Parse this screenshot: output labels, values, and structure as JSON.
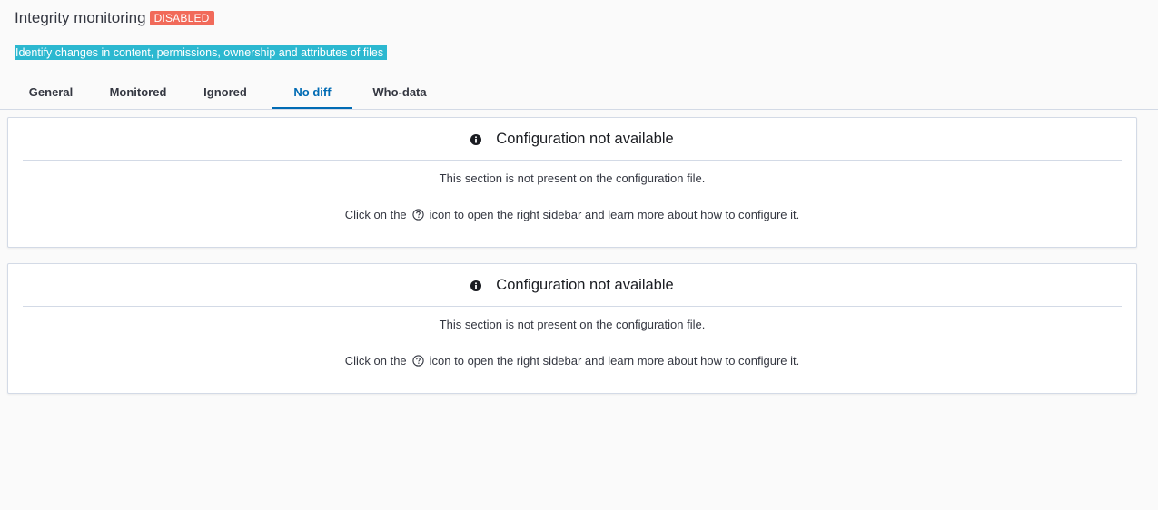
{
  "header": {
    "title": "Integrity monitoring",
    "status_badge": "DISABLED",
    "subtitle": "Identify changes in content, permissions, ownership and attributes of files"
  },
  "tabs": [
    {
      "label": "General",
      "active": false
    },
    {
      "label": "Monitored",
      "active": false
    },
    {
      "label": "Ignored",
      "active": false
    },
    {
      "label": "No diff",
      "active": true
    },
    {
      "label": "Who-data",
      "active": false
    }
  ],
  "panels": [
    {
      "title": "Configuration not available",
      "icon": "info-icon",
      "message": "This section is not present on the configuration file.",
      "help_prefix": "Click on the",
      "help_icon": "question-circle-icon",
      "help_suffix": "icon to open the right sidebar and learn more about how to configure it."
    },
    {
      "title": "Configuration not available",
      "icon": "info-icon",
      "message": "This section is not present on the configuration file.",
      "help_prefix": "Click on the",
      "help_icon": "question-circle-icon",
      "help_suffix": "icon to open the right sidebar and learn more about how to configure it."
    }
  ],
  "colors": {
    "badge": "#f16a5a",
    "subtitle_highlight": "#2cb8d0",
    "active_tab": "#006bb4"
  }
}
